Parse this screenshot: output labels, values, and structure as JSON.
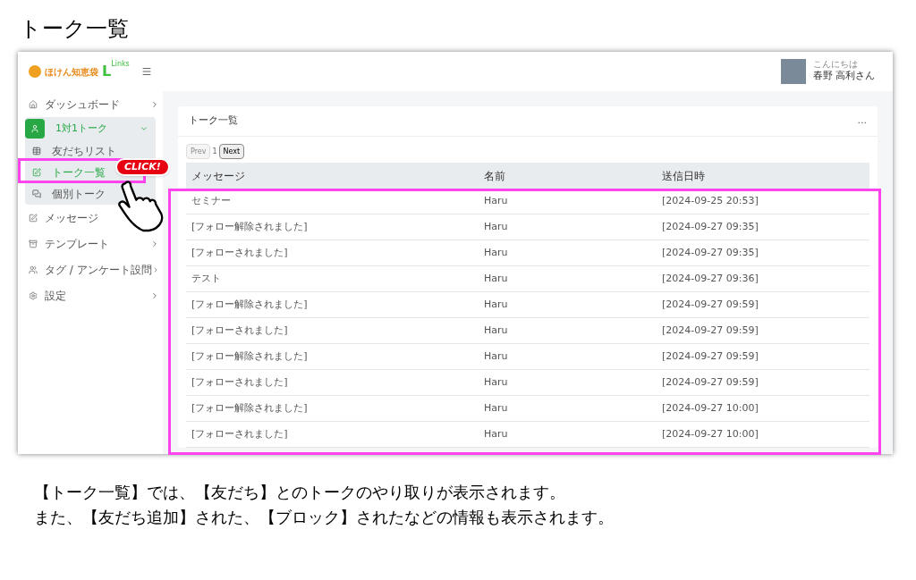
{
  "page_title": "トーク一覧",
  "app": {
    "logo": {
      "name": "ほけん知恵袋",
      "mark": "L",
      "mark_sub": "Links"
    },
    "sidebar": {
      "items": [
        {
          "label": "ダッシュボード",
          "kind": "link",
          "chevron": true
        },
        {
          "label": "1対1トーク",
          "kind": "group",
          "expanded": true,
          "children": [
            {
              "label": "友だちリスト",
              "selected": false
            },
            {
              "label": "トーク一覧",
              "selected": true
            },
            {
              "label": "個別トーク",
              "selected": false
            }
          ]
        },
        {
          "label": "メッセージ",
          "kind": "link",
          "chevron": false
        },
        {
          "label": "テンプレート",
          "kind": "link",
          "chevron": true
        },
        {
          "label": "タグ / アンケート設問",
          "kind": "link",
          "chevron": true
        },
        {
          "label": "設定",
          "kind": "link",
          "chevron": true
        }
      ]
    },
    "header": {
      "greeting": "こんにちは",
      "user_name": "春野 高利さん"
    },
    "card": {
      "title": "トーク一覧",
      "menu": "...",
      "pagination": {
        "prev": "Prev",
        "prev_disabled": true,
        "page": "1",
        "next": "Next"
      },
      "table": {
        "columns": [
          "メッセージ",
          "名前",
          "送信日時"
        ],
        "rows": [
          [
            "セミナー",
            "Haru",
            "[2024-09-25 20:53]"
          ],
          [
            "[フォロー解除されました]",
            "Haru",
            "[2024-09-27 09:35]"
          ],
          [
            "[フォローされました]",
            "Haru",
            "[2024-09-27 09:35]"
          ],
          [
            "テスト",
            "Haru",
            "[2024-09-27 09:36]"
          ],
          [
            "[フォロー解除されました]",
            "Haru",
            "[2024-09-27 09:59]"
          ],
          [
            "[フォローされました]",
            "Haru",
            "[2024-09-27 09:59]"
          ],
          [
            "[フォロー解除されました]",
            "Haru",
            "[2024-09-27 09:59]"
          ],
          [
            "[フォローされました]",
            "Haru",
            "[2024-09-27 09:59]"
          ],
          [
            "[フォロー解除されました]",
            "Haru",
            "[2024-09-27 10:00]"
          ],
          [
            "[フォローされました]",
            "Haru",
            "[2024-09-27 10:00]"
          ]
        ]
      }
    }
  },
  "callout": {
    "badge": "CLICK!"
  },
  "caption": [
    "【トーク一覧】では、【友だち】とのトークのやり取りが表示されます。",
    "また、【友だち追加】された、【ブロック】されたなどの情報も表示されます。"
  ]
}
